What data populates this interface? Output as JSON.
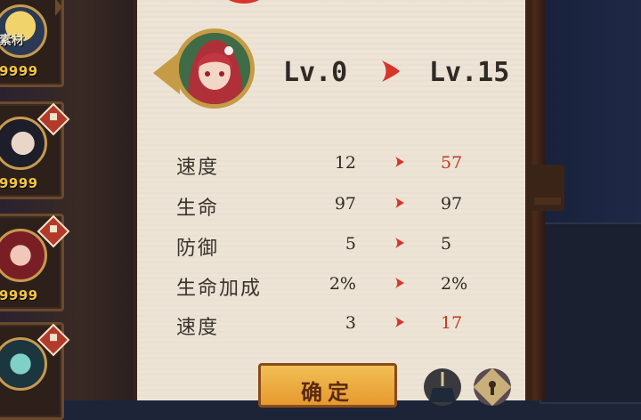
{
  "left_cards": [
    {
      "count": "9999",
      "label": "素材"
    },
    {
      "count": "9999"
    },
    {
      "count": "9999"
    }
  ],
  "level": {
    "current": "Lv.0",
    "target": "Lv.15"
  },
  "stats": [
    {
      "name": "速度",
      "old": "12",
      "new": "57",
      "increased": true
    },
    {
      "name": "生命",
      "old": "97",
      "new": "97",
      "increased": false
    },
    {
      "name": "防御",
      "old": "5",
      "new": "5",
      "increased": false
    },
    {
      "name": "生命加成",
      "old": "2%",
      "new": "2%",
      "increased": false
    },
    {
      "name": "速度",
      "old": "3",
      "new": "17",
      "increased": true
    }
  ],
  "confirm_button": {
    "label": "确定"
  },
  "colors": {
    "accent_red": "#c4381f",
    "arrow_red": "#d8352a",
    "gold": "#c69b45",
    "button": "#f2bf55"
  },
  "icons": [
    "broom-icon",
    "keyhole-lock-icon",
    "arrow-right-icon",
    "card-badge-icon"
  ]
}
